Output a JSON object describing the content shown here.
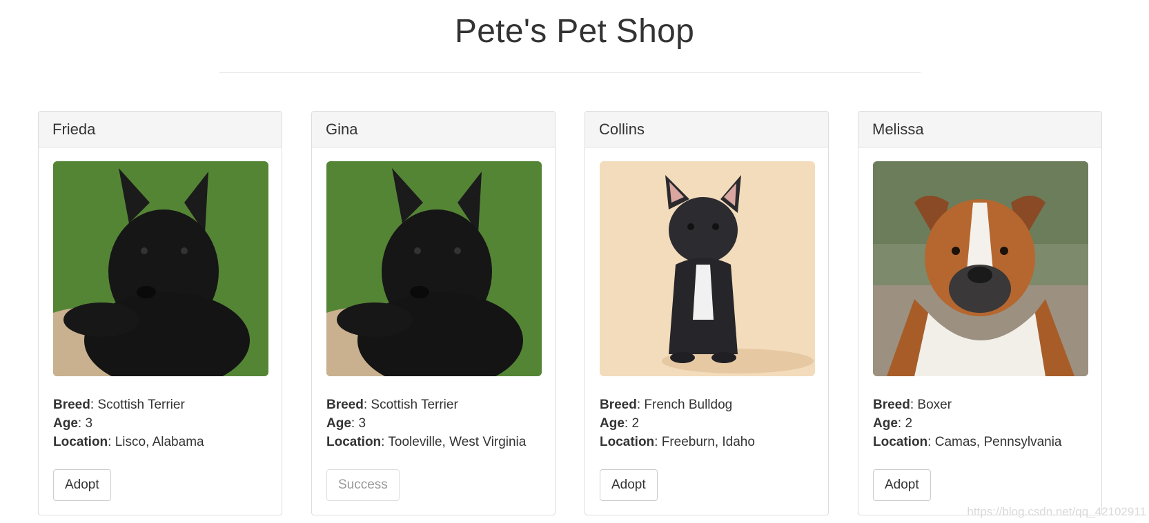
{
  "page": {
    "title": "Pete's Pet Shop"
  },
  "labels": {
    "breed": "Breed",
    "age": "Age",
    "location": "Location"
  },
  "pets": [
    {
      "name": "Frieda",
      "breed": "Scottish Terrier",
      "age": "3",
      "location": "Lisco, Alabama",
      "button": "Adopt",
      "button_disabled": false,
      "photo": "scottish-terrier-photo"
    },
    {
      "name": "Gina",
      "breed": "Scottish Terrier",
      "age": "3",
      "location": "Tooleville, West Virginia",
      "button": "Success",
      "button_disabled": true,
      "photo": "scottish-terrier-photo"
    },
    {
      "name": "Collins",
      "breed": "French Bulldog",
      "age": "2",
      "location": "Freeburn, Idaho",
      "button": "Adopt",
      "button_disabled": false,
      "photo": "french-bulldog-photo"
    },
    {
      "name": "Melissa",
      "breed": "Boxer",
      "age": "2",
      "location": "Camas, Pennsylvania",
      "button": "Adopt",
      "button_disabled": false,
      "photo": "boxer-photo"
    }
  ],
  "watermark": "https://blog.csdn.net/qq_42102911",
  "colors": {
    "panel_heading_bg": "#f5f5f5",
    "border": "#dddddd",
    "text": "#333333",
    "disabled_text": "#999999"
  }
}
